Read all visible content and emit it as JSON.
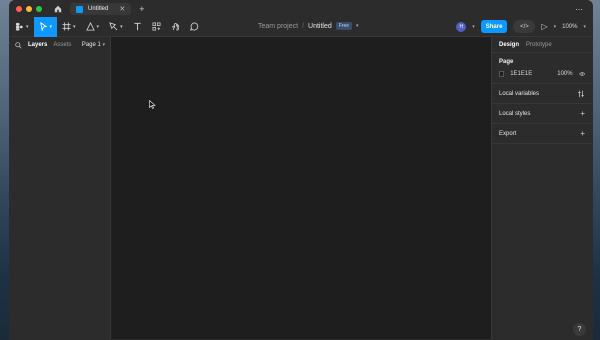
{
  "tabbar": {
    "tab_title": "Untitled",
    "close_glyph": "✕",
    "new_tab_glyph": "+",
    "more_glyph": "⋯"
  },
  "toolbar": {
    "breadcrumb_team": "Team project",
    "separator": "/",
    "doc_name": "Untitled",
    "plan_badge": "Free",
    "avatar_initial": "H",
    "share_label": "Share",
    "devmode_glyph": "</>",
    "zoom_label": "100%"
  },
  "left_panel": {
    "layers_tab": "Layers",
    "assets_tab": "Assets",
    "page_selector": "Page 1"
  },
  "right_panel": {
    "design_tab": "Design",
    "prototype_tab": "Prototype",
    "page_section": "Page",
    "page_color": "1E1E1E",
    "page_opacity": "100%",
    "local_variables": "Local variables",
    "local_styles": "Local styles",
    "export": "Export",
    "help_glyph": "?"
  },
  "colors": {
    "accent": "#0d99ff",
    "canvas": "#1e1e1e",
    "panel": "#2c2c2c"
  },
  "icons": [
    "home-icon",
    "figma-menu-icon",
    "move-tool-icon",
    "frame-tool-icon",
    "shape-tool-icon",
    "pen-tool-icon",
    "text-tool-icon",
    "resources-icon",
    "hand-tool-icon",
    "comment-icon",
    "search-icon",
    "eye-icon",
    "variables-icon",
    "plus-icon",
    "play-icon",
    "cursor-icon"
  ]
}
